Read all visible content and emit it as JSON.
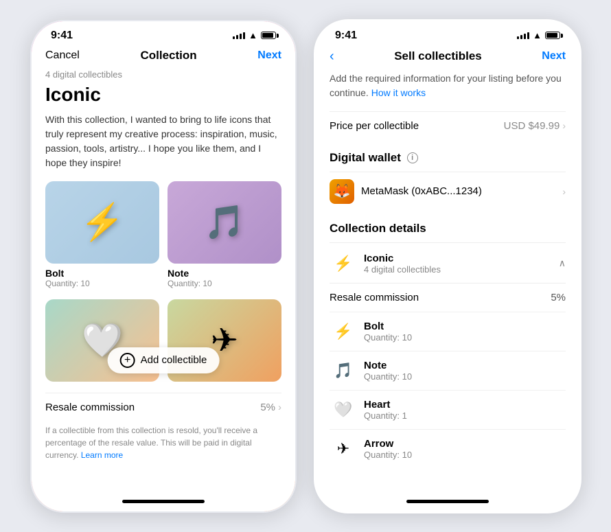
{
  "left_phone": {
    "status": {
      "time": "9:41",
      "signal": true,
      "wifi": true,
      "battery": true
    },
    "nav": {
      "cancel": "Cancel",
      "title": "Collection",
      "next": "Next"
    },
    "collection": {
      "subtitle": "4 digital collectibles",
      "title": "Iconic",
      "description": "With this collection, I wanted to bring to life icons that truly represent my creative process: inspiration, music, passion, tools, artistry... I hope you like them, and I hope they inspire!"
    },
    "nfts": [
      {
        "name": "Bolt",
        "quantity": "Quantity: 10",
        "bg": "bolt-bg",
        "icon": "⚡"
      },
      {
        "name": "Note",
        "quantity": "Quantity: 10",
        "bg": "note-bg",
        "icon": "♪"
      }
    ],
    "bottom_nfts": [
      {
        "name": "",
        "quantity": "",
        "bg": "heart-bg",
        "icon": "🤍"
      },
      {
        "name": "",
        "quantity": "",
        "bg": "arrow-bg",
        "icon": "✈"
      }
    ],
    "add_collectible": "Add collectible",
    "resale": {
      "label": "Resale commission",
      "value": "5%",
      "description": "If a collectible from this collection is resold, you'll receive a percentage of the resale value. This will be paid in digital currency.",
      "learn_more": "Learn more"
    }
  },
  "right_phone": {
    "status": {
      "time": "9:41"
    },
    "nav": {
      "back": "<",
      "title": "Sell collectibles",
      "next": "Next"
    },
    "info_text": "Add the required information for your listing before you continue.",
    "how_it_works": "How it works",
    "price": {
      "label": "Price per collectible",
      "value": "USD $49.99"
    },
    "wallet": {
      "heading": "Digital wallet",
      "name": "MetaMask (0xABC...1234)"
    },
    "collection_details": {
      "heading": "Collection details",
      "name": "Iconic",
      "count": "4 digital collectibles"
    },
    "resale": {
      "label": "Resale commission",
      "value": "5%"
    },
    "nfts": [
      {
        "name": "Bolt",
        "quantity": "Quantity: 10",
        "bg": "bolt-bg",
        "icon": "⚡"
      },
      {
        "name": "Note",
        "quantity": "Quantity: 10",
        "bg": "note-bg",
        "icon": "♪"
      },
      {
        "name": "Heart",
        "quantity": "Quantity: 1",
        "bg": "heart-bg",
        "icon": "🤍"
      },
      {
        "name": "Arrow",
        "quantity": "Quantity: 10",
        "bg": "arrow-bg",
        "icon": "✈"
      }
    ]
  }
}
